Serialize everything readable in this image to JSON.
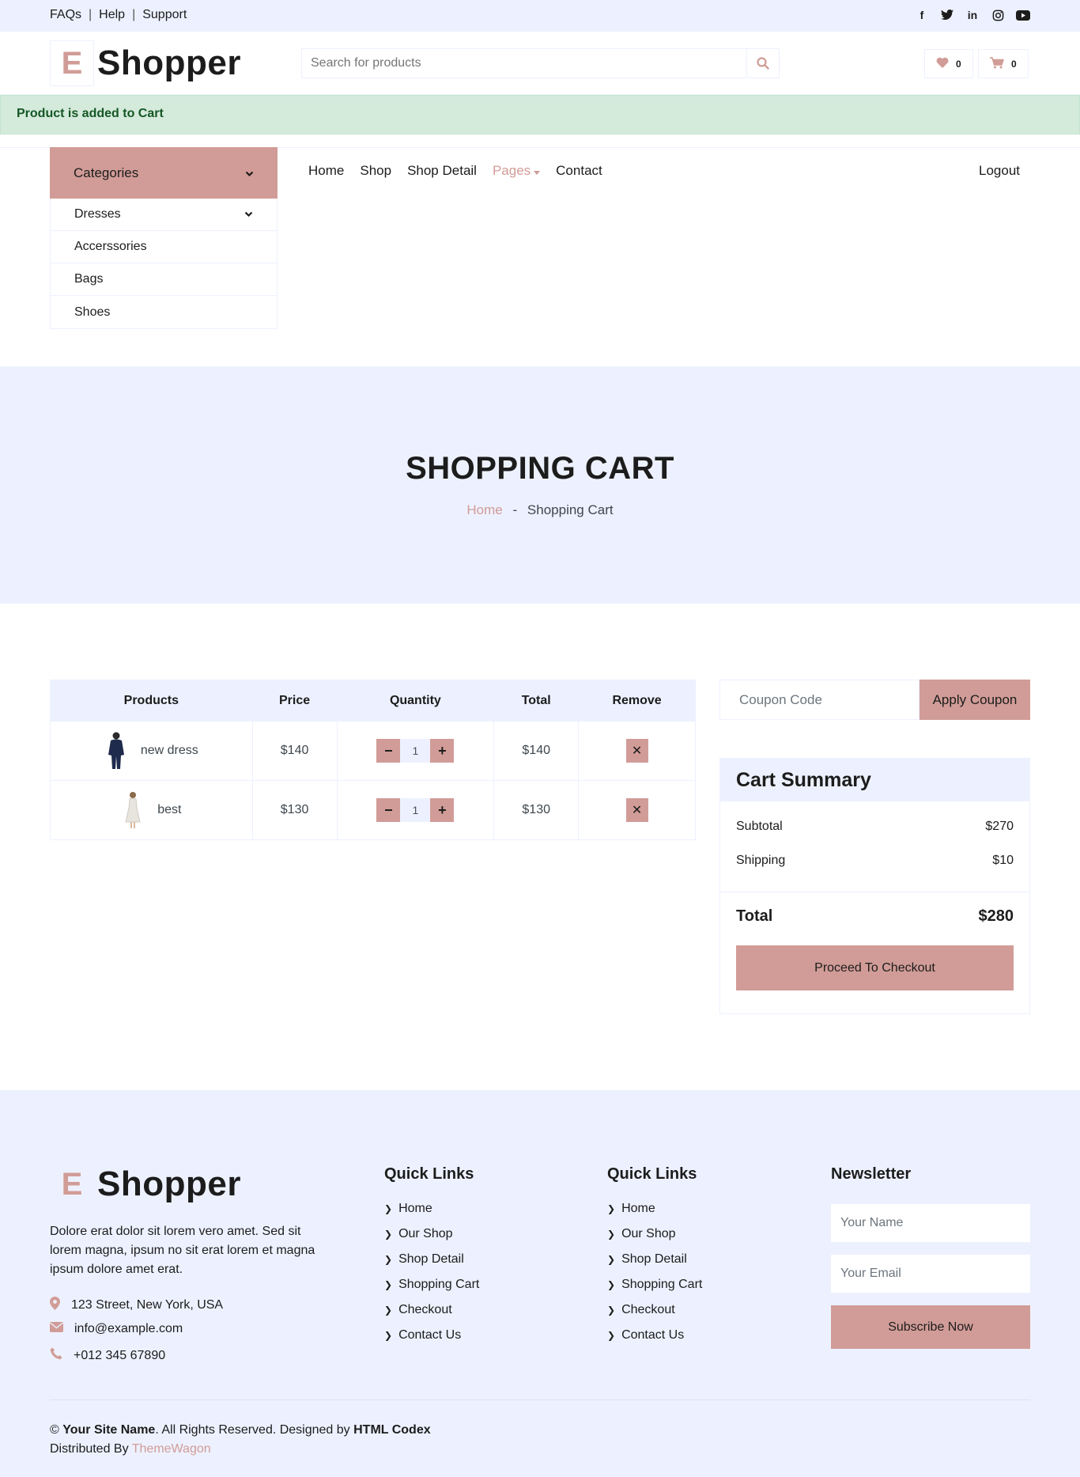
{
  "topbar": {
    "links": [
      "FAQs",
      "Help",
      "Support"
    ],
    "social": [
      "facebook-icon",
      "twitter-icon",
      "linkedin-icon",
      "instagram-icon",
      "youtube-icon"
    ]
  },
  "brand": {
    "letter": "E",
    "name": "Shopper"
  },
  "search": {
    "placeholder": "Search for products"
  },
  "header": {
    "wishlist_count": "0",
    "cart_count": "0"
  },
  "alert": {
    "text": "Product is added to Cart"
  },
  "categories": {
    "title": "Categories",
    "items": [
      "Dresses",
      "Accerssories",
      "Bags",
      "Shoes"
    ]
  },
  "nav": {
    "items": [
      "Home",
      "Shop",
      "Shop Detail",
      "Pages",
      "Contact"
    ],
    "active": "Pages",
    "logout": "Logout"
  },
  "page_header": {
    "title": "SHOPPING CART",
    "breadcrumb_home": "Home",
    "breadcrumb_sep": "-",
    "breadcrumb_current": "Shopping Cart"
  },
  "cart": {
    "columns": [
      "Products",
      "Price",
      "Quantity",
      "Total",
      "Remove"
    ],
    "rows": [
      {
        "name": "new dress",
        "price": "$140",
        "qty": "1",
        "total": "$140"
      },
      {
        "name": "best",
        "price": "$130",
        "qty": "1",
        "total": "$130"
      }
    ],
    "minus": "−",
    "plus": "+",
    "remove": "✕"
  },
  "coupon": {
    "placeholder": "Coupon Code",
    "button": "Apply Coupon"
  },
  "summary": {
    "title": "Cart Summary",
    "subtotal_label": "Subtotal",
    "subtotal": "$270",
    "shipping_label": "Shipping",
    "shipping": "$10",
    "total_label": "Total",
    "total": "$280",
    "checkout": "Proceed To Checkout"
  },
  "footer": {
    "description": "Dolore erat dolor sit lorem vero amet. Sed sit lorem magna, ipsum no sit erat lorem et magna ipsum dolore amet erat.",
    "address": "123 Street, New York, USA",
    "email": "info@example.com",
    "phone": "+012 345 67890",
    "col1_title": "Quick Links",
    "col2_title": "Quick Links",
    "links": [
      "Home",
      "Our Shop",
      "Shop Detail",
      "Shopping Cart",
      "Checkout",
      "Contact Us"
    ],
    "newsletter_title": "Newsletter",
    "name_placeholder": "Your Name",
    "email_placeholder": "Your Email",
    "subscribe": "Subscribe Now",
    "copy_symbol": "©",
    "site_name": "Your Site Name",
    "rights": ". All Rights Reserved. Designed by ",
    "designer": "HTML Codex",
    "distributed": "Distributed By ",
    "distributor": "ThemeWagon"
  },
  "colors": {
    "accent": "#d19c97",
    "light": "#edf1ff",
    "dark": "#1c1c1c",
    "alert_bg": "#d4eadb",
    "alert_text": "#155724"
  }
}
